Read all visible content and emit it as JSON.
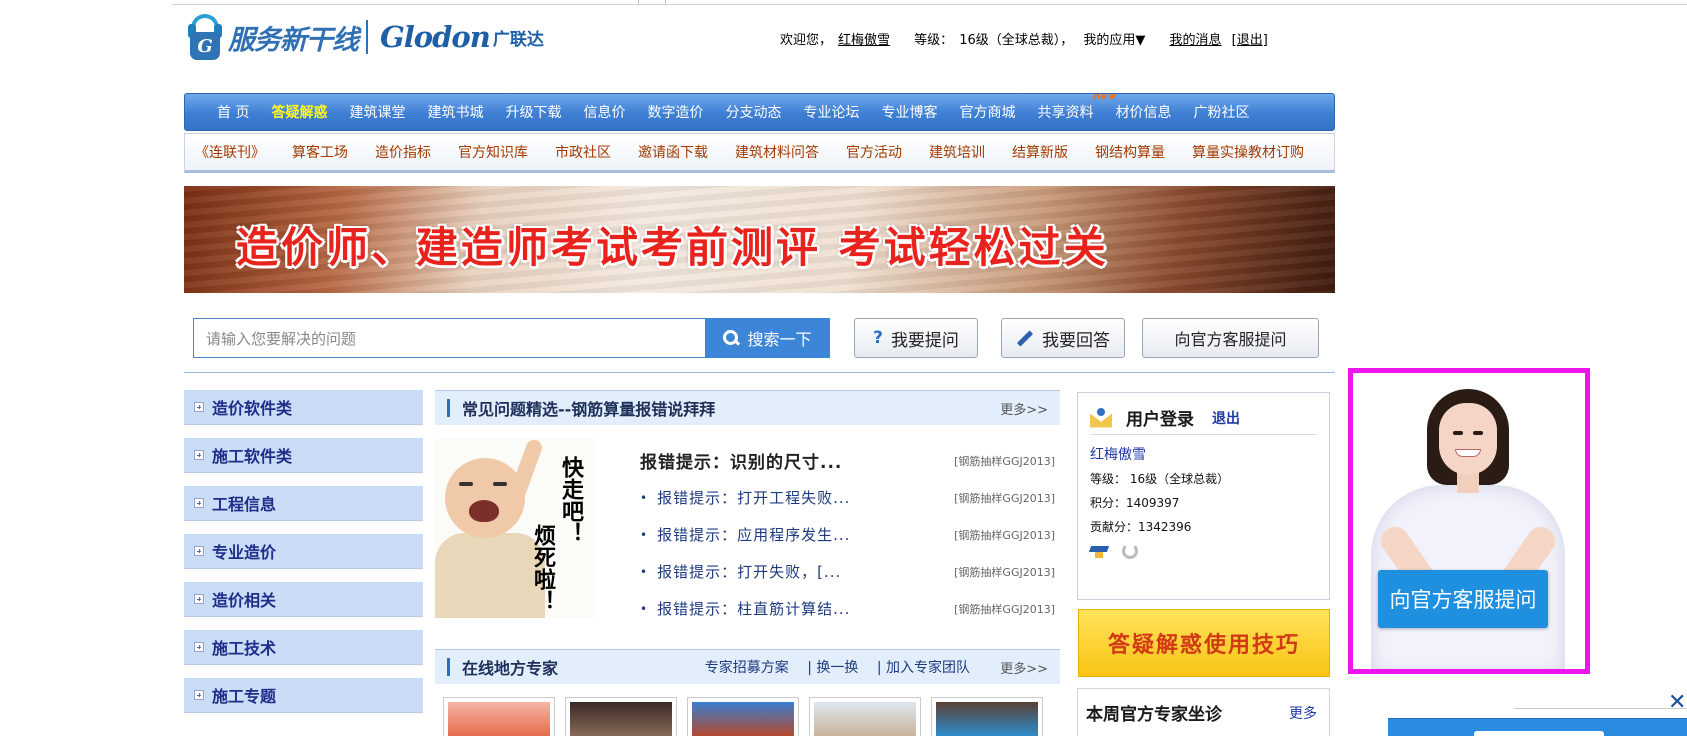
{
  "header": {
    "logo_text_cn": "服务新干线",
    "logo_text_en": "Glodon",
    "logo_text_brand": "广联达",
    "user": {
      "welcome_prefix": "欢迎您，",
      "username": "红梅傲雪",
      "level_label": "等级：",
      "level_value": "16级（全球总裁），",
      "my_apps": "我的应用▼",
      "my_messages": "我的消息",
      "logout": "[退出]"
    }
  },
  "main_nav": {
    "items": [
      {
        "label": "首 页",
        "active": false
      },
      {
        "label": "答疑解惑",
        "active": true
      },
      {
        "label": "建筑课堂",
        "active": false
      },
      {
        "label": "建筑书城",
        "active": false
      },
      {
        "label": "升级下载",
        "active": false
      },
      {
        "label": "信息价",
        "active": false
      },
      {
        "label": "数字造价",
        "active": false
      },
      {
        "label": "分支动态",
        "active": false
      },
      {
        "label": "专业论坛",
        "active": false
      },
      {
        "label": "专业博客",
        "active": false
      },
      {
        "label": "官方商城",
        "active": false
      },
      {
        "label": "共享资料",
        "active": false,
        "badge": "new"
      },
      {
        "label": "材价信息",
        "active": false
      },
      {
        "label": "广粉社区",
        "active": false
      }
    ]
  },
  "sub_nav": {
    "items": [
      "《连联刊》",
      "算客工场",
      "造价指标",
      "官方知识库",
      "市政社区",
      "邀请函下载",
      "建筑材料问答",
      "官方活动",
      "建筑培训",
      "结算新版",
      "钢结构算量",
      "算量实操教材订购"
    ]
  },
  "banner": {
    "text": "造价师、建造师考试考前测评   考试轻松过关"
  },
  "search": {
    "placeholder": "请输入您要解决的问题",
    "button": "搜索一下",
    "ask_button": "我要提问",
    "answer_button": "我要回答",
    "official_button": "向官方客服提问"
  },
  "categories": [
    "造价软件类",
    "施工软件类",
    "工程信息",
    "专业造价",
    "造价相关",
    "施工技术",
    "施工专题"
  ],
  "faq": {
    "title": "常见问题精选--钢筋算量报错说拜拜",
    "more": "更多>>",
    "meme_text_1": "快走吧！",
    "meme_text_2": "烦死啦！",
    "items": [
      {
        "title": "报错提示：识别的尺寸...",
        "tag": "[钢筋抽样GGJ2013]"
      },
      {
        "title": "报错提示：打开工程失败...",
        "tag": "[钢筋抽样GGJ2013]"
      },
      {
        "title": "报错提示：应用程序发生...",
        "tag": "[钢筋抽样GGJ2013]"
      },
      {
        "title": "报错提示：打开失败，[...",
        "tag": "[钢筋抽样GGJ2013]"
      },
      {
        "title": "报错提示：柱直筋计算结...",
        "tag": "[钢筋抽样GGJ2013]"
      }
    ]
  },
  "experts_panel": {
    "title": "在线地方专家",
    "links": [
      "专家招募方案",
      "|",
      "换一换",
      "|",
      "加入专家团队"
    ],
    "more": "更多>>"
  },
  "login_box": {
    "title": "用户登录",
    "logout": "退出",
    "username": "红梅傲雪",
    "level": "等级： 16级（全球总裁）",
    "points": "积分：1409397",
    "contribution": "贡献分：1342396"
  },
  "tips_button": "答疑解惑使用技巧",
  "weekly": {
    "title": "本周官方专家坐诊",
    "more": "更多"
  },
  "float_ad": {
    "button": "向官方客服提问"
  },
  "colors": {
    "nav_blue": "#3e7fd4",
    "active_yellow": "#fff71f",
    "ad_border": "#ee14ee",
    "subnav_text": "#a33a00"
  }
}
